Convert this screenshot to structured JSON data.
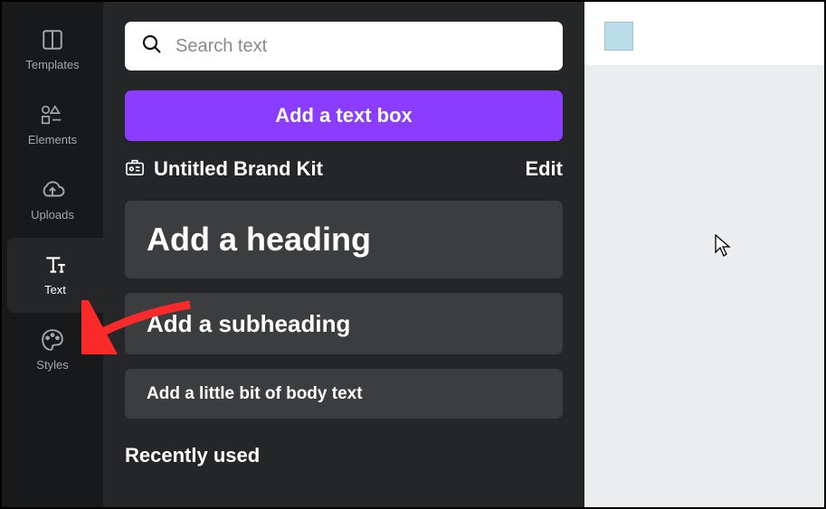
{
  "sidebar": {
    "items": [
      {
        "label": "Templates"
      },
      {
        "label": "Elements"
      },
      {
        "label": "Uploads"
      },
      {
        "label": "Text"
      },
      {
        "label": "Styles"
      }
    ]
  },
  "search": {
    "placeholder": "Search text"
  },
  "addTextBox": "Add a text box",
  "brandKit": {
    "name": "Untitled Brand Kit",
    "edit": "Edit"
  },
  "blocks": {
    "heading": "Add a heading",
    "subheading": "Add a subheading",
    "body": "Add a little bit of body text"
  },
  "recentlyUsed": "Recently used"
}
